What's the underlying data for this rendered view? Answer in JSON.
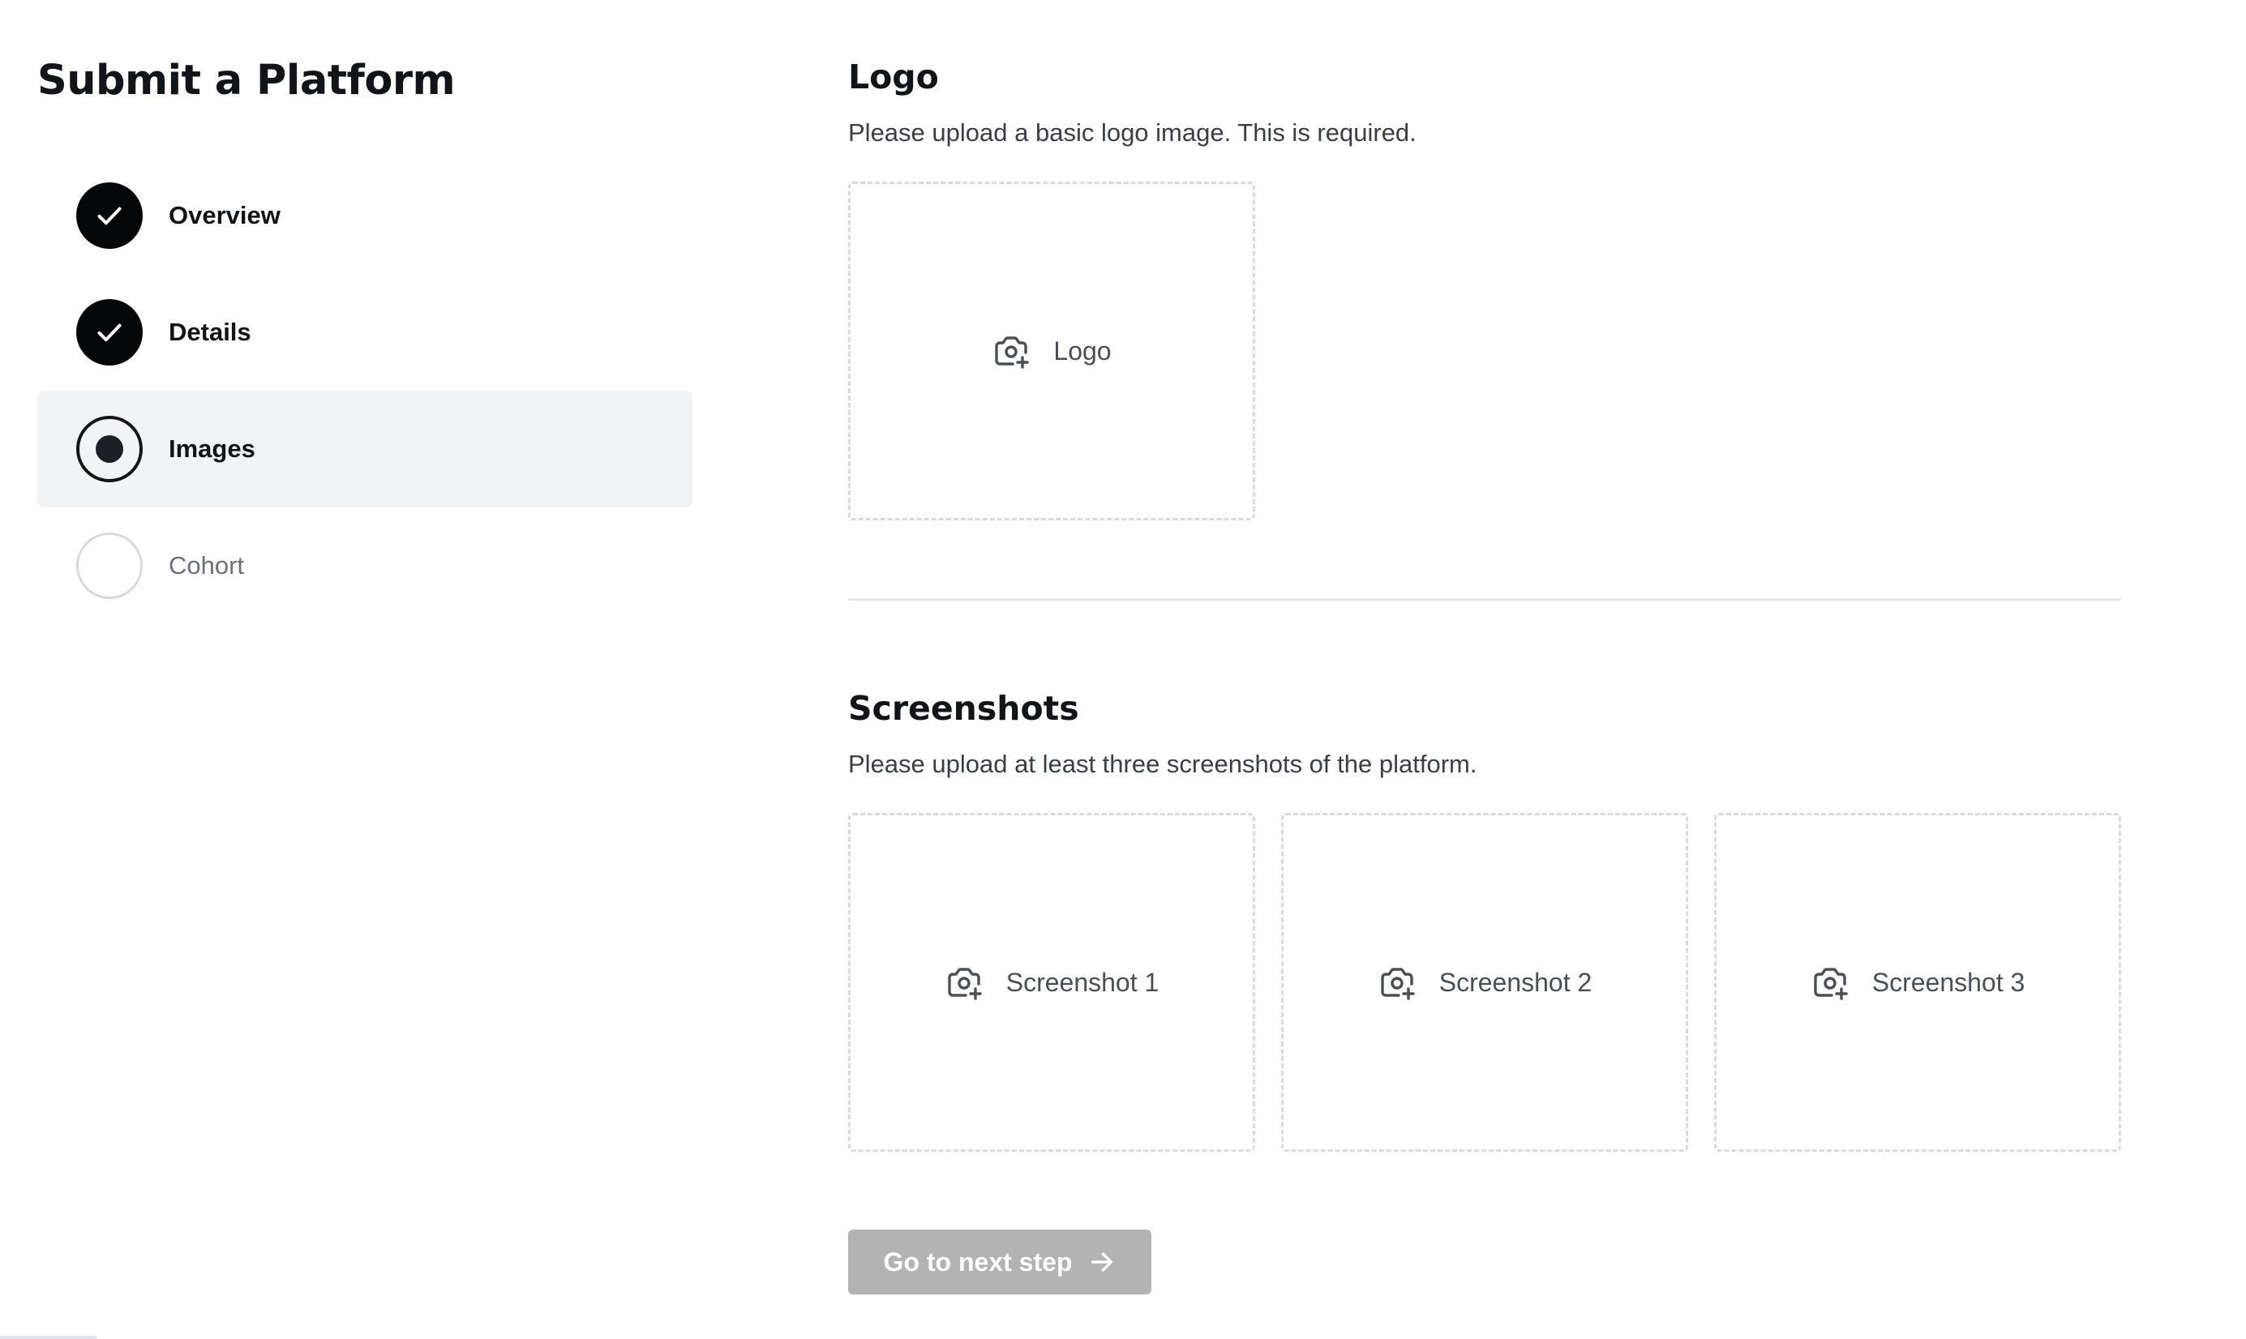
{
  "sidebar": {
    "title": "Submit a Platform",
    "steps": [
      {
        "label": "Overview",
        "state": "done"
      },
      {
        "label": "Details",
        "state": "done"
      },
      {
        "label": "Images",
        "state": "active"
      },
      {
        "label": "Cohort",
        "state": "todo"
      }
    ]
  },
  "logo_section": {
    "title": "Logo",
    "description": "Please upload a basic logo image. This is required.",
    "upload_label": "Logo"
  },
  "screenshots_section": {
    "title": "Screenshots",
    "description": "Please upload at least three screenshots of the platform.",
    "uploads": [
      {
        "label": "Screenshot 1"
      },
      {
        "label": "Screenshot 2"
      },
      {
        "label": "Screenshot 3"
      }
    ]
  },
  "next_button": {
    "label": "Go to next step",
    "enabled": false
  },
  "icons": {
    "done": "check-icon",
    "active": "radio-dot-icon",
    "upload": "camera-plus-icon",
    "next": "arrow-right-icon"
  },
  "colors": {
    "step_done": "#050608",
    "current_step_bg": "#f2f3f5",
    "upload_border": "#d9dbdf",
    "button_disabled": "#b3b3b3"
  }
}
